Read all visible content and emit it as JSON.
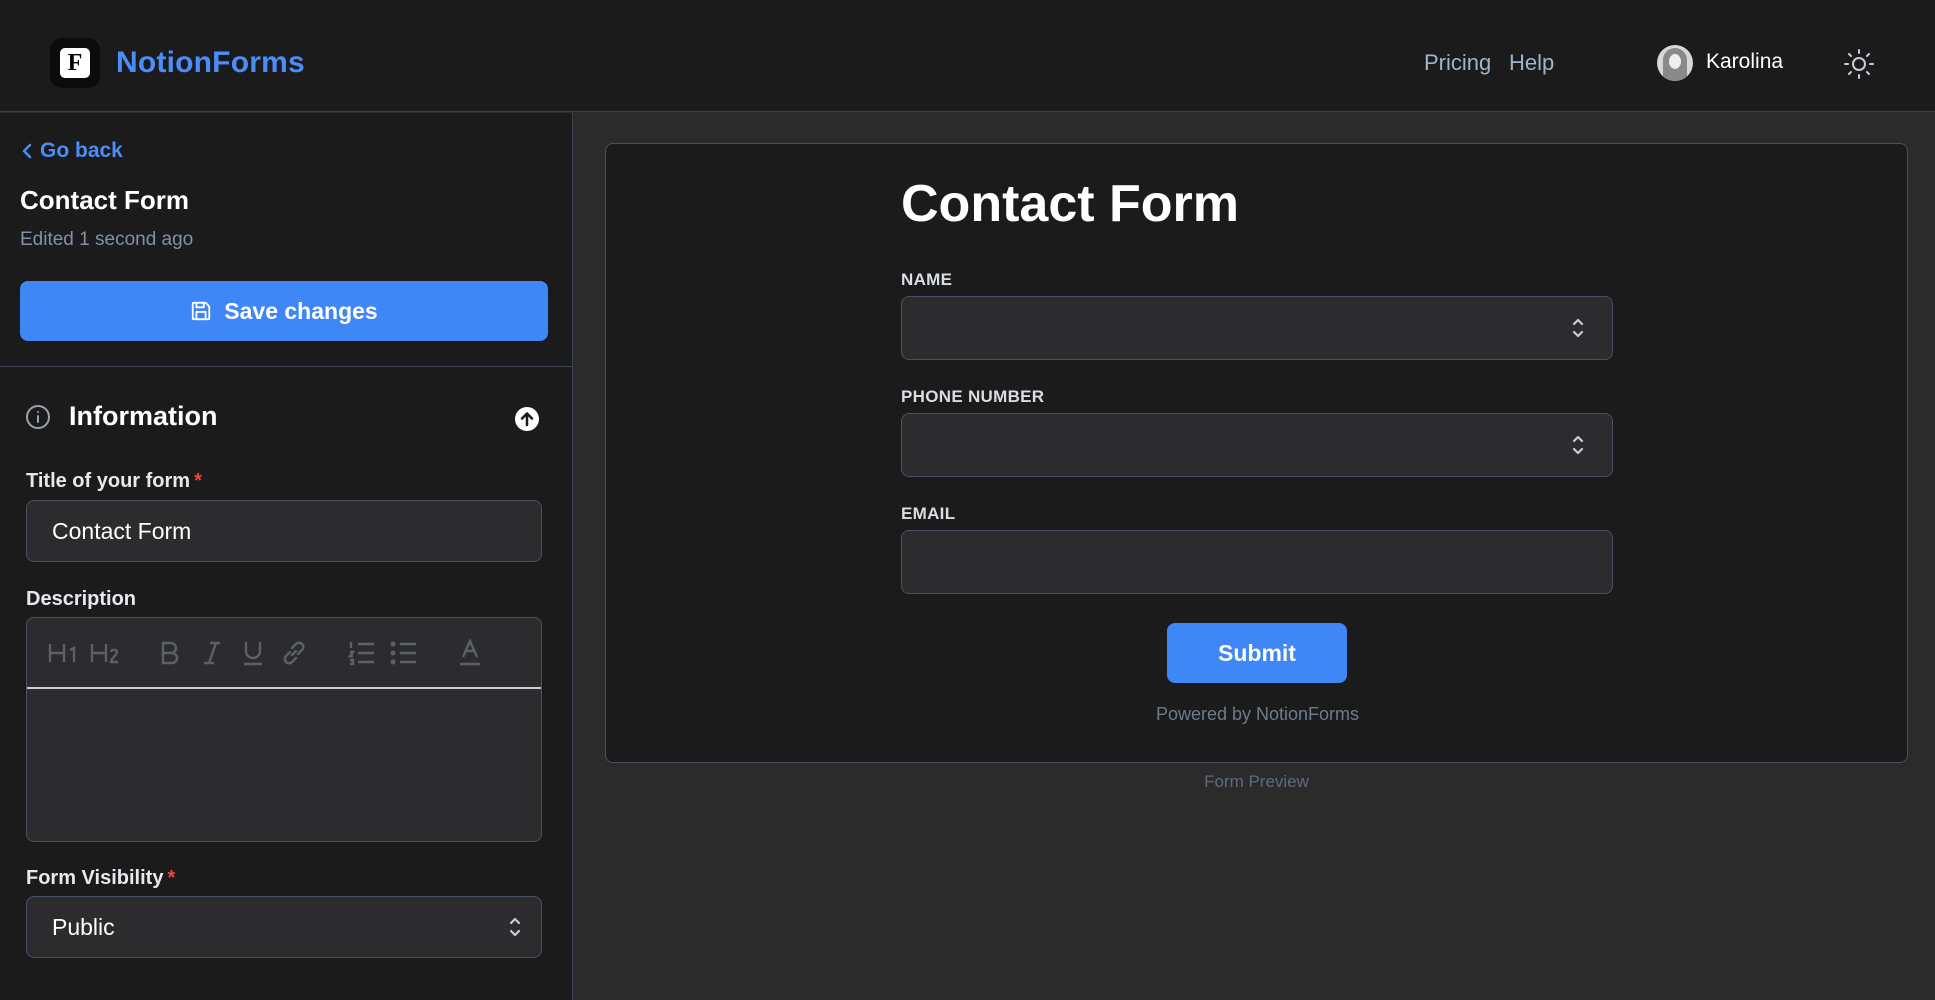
{
  "header": {
    "logo_letter": "F",
    "brand": "NotionForms",
    "nav": [
      "Pricing",
      "Help"
    ],
    "user_name": "Karolina",
    "theme_icon": "sun-icon"
  },
  "sidebar": {
    "go_back": "Go back",
    "form_title": "Contact Form",
    "edited": "Edited 1 second ago",
    "save_label": "Save changes",
    "section_title": "Information",
    "title_label": "Title of your form",
    "title_value": "Contact Form",
    "description_label": "Description",
    "editor_toolbar": [
      "H1",
      "H2",
      "bold",
      "italic",
      "underline",
      "link",
      "ordered-list",
      "bullet-list",
      "text-color"
    ],
    "visibility_label": "Form Visibility",
    "visibility_value": "Public",
    "required_mark": "*"
  },
  "preview": {
    "title": "Contact Form",
    "fields": [
      {
        "label": "NAME",
        "type": "select"
      },
      {
        "label": "PHONE NUMBER",
        "type": "select"
      },
      {
        "label": "EMAIL",
        "type": "text"
      }
    ],
    "submit_label": "Submit",
    "powered_by": "Powered by NotionForms",
    "caption": "Form Preview"
  },
  "colors": {
    "accent": "#3f86f6",
    "brand": "#4a8dfb",
    "required": "#ef4444",
    "background": "#1b1b1c"
  }
}
